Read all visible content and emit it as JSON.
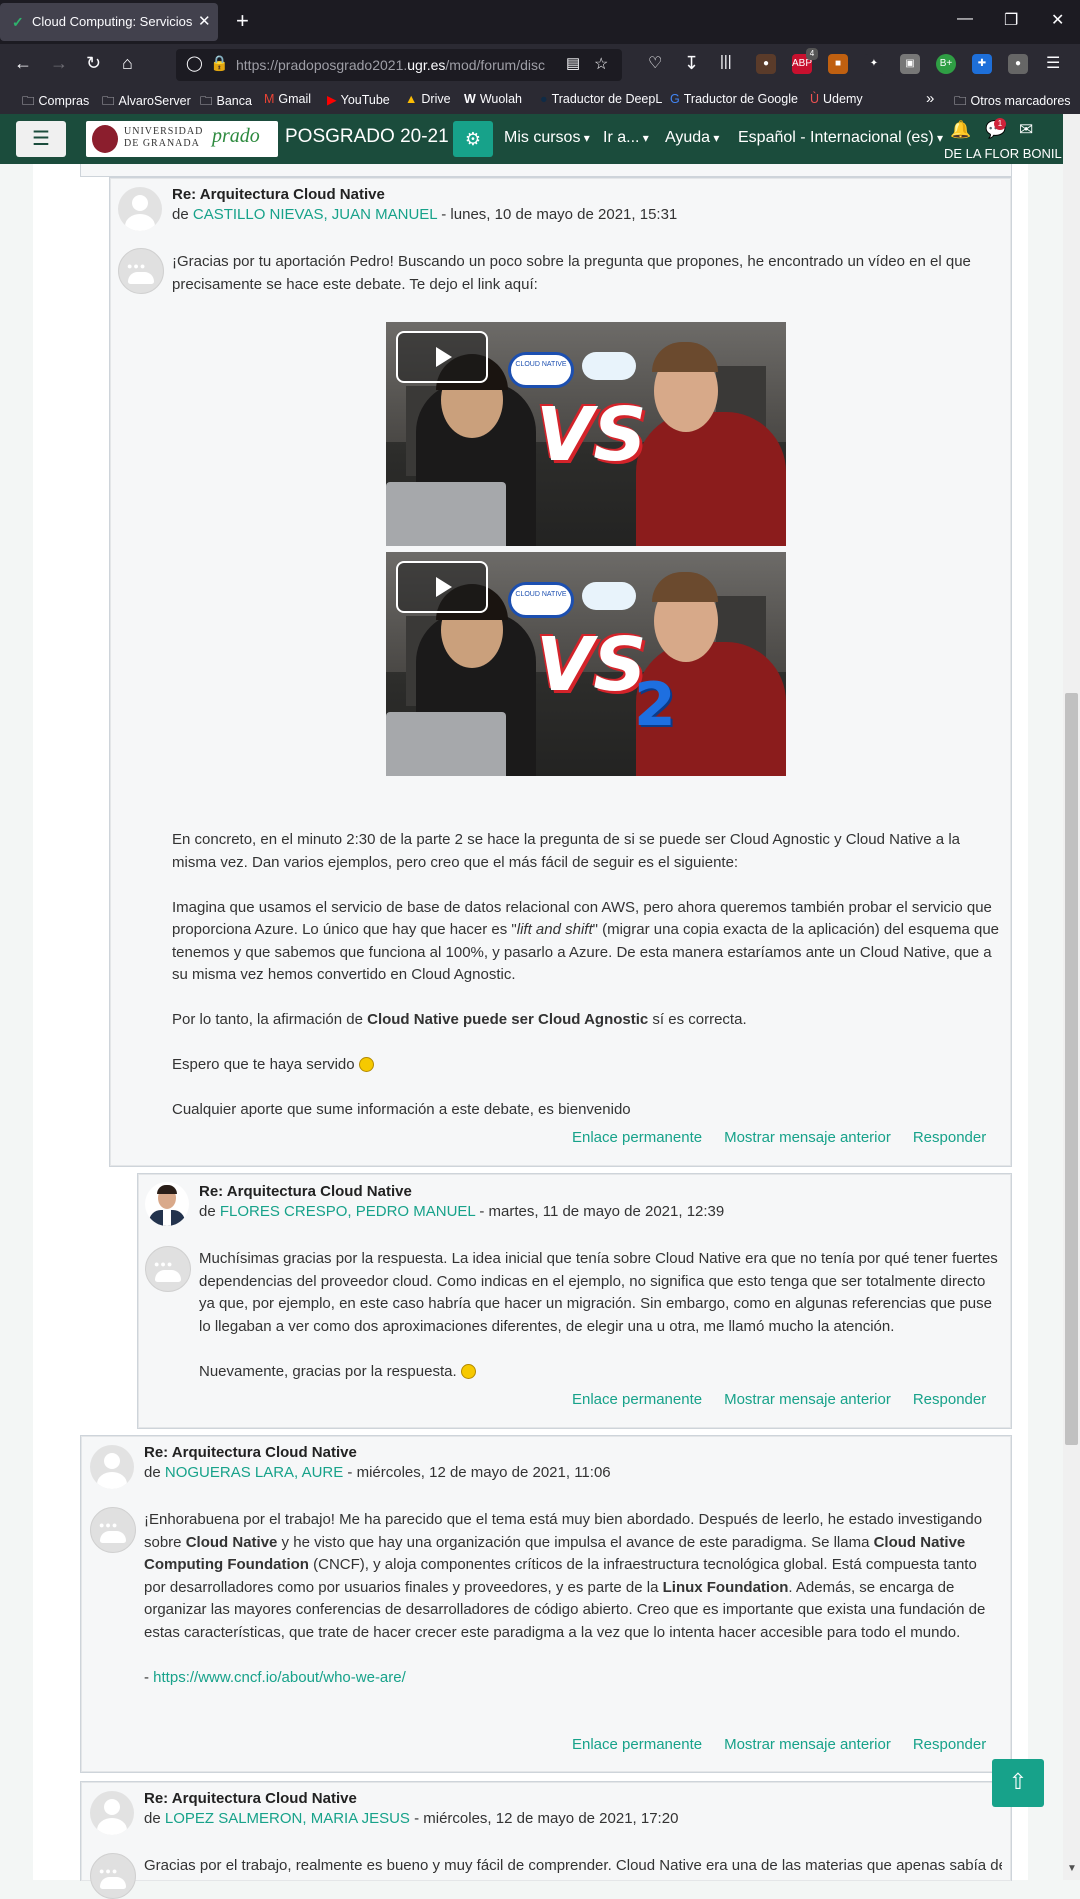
{
  "browser": {
    "tab_title": "Cloud Computing: Servicios y A",
    "url_prefix": "https://pradoposgrado2021.",
    "url_domain": "ugr.es",
    "url_suffix": "/mod/forum/disc",
    "bookmarks": [
      "Compras",
      "AlvaroServer",
      "Banca",
      "Gmail",
      "YouTube",
      "Drive",
      "Wuolah",
      "Traductor de DeepL",
      "Traductor de Google",
      "Udemy"
    ],
    "other_bookmarks": "Otros marcadores",
    "ext_badge": "4"
  },
  "header": {
    "university": "UNIVERSIDAD\nDE GRANADA",
    "prado": "prado",
    "site_title": "POSGRADO 20-21",
    "menu": [
      "Mis cursos",
      "Ir a...",
      "Ayuda",
      "Español - Internacional (es)"
    ],
    "notification_count": "1",
    "user_name": "DE LA FLOR BONIL"
  },
  "posts": [
    {
      "title": "Re: Arquitectura Cloud Native",
      "by": "de",
      "author": "CASTILLO NIEVAS, JUAN MANUEL",
      "date": " - lunes, 10 de mayo de 2021, 15:31",
      "intro": "¡Gracias por tu aportación Pedro! Buscando un poco sobre la pregunta que propones, he encontrado un vídeo en el que precisamente se hace este debate. Te dejo el link aquí:",
      "videos": [
        {
          "cloud_label": "CLOUD NATIVE",
          "vs": "VS",
          "part": ""
        },
        {
          "cloud_label": "CLOUD NATIVE",
          "vs": "VS",
          "part": "2"
        }
      ],
      "p1": "En concreto, en el minuto 2:30 de la parte 2 se hace la pregunta de si se puede ser Cloud Agnostic y Cloud Native a la misma vez. Dan varios ejemplos, pero creo que el más fácil de seguir es el siguiente:",
      "p2a": "Imagina que usamos el servicio de base de datos relacional con AWS, pero ahora queremos también probar el servicio que proporciona Azure. Lo único que hay que hacer es \"",
      "p2em": "lift and shift",
      "p2b": "\" (migrar una copia exacta de la aplicación) del esquema que tenemos y que sabemos que funciona al 100%, y pasarlo a Azure. De esta manera estaríamos ante un Cloud Native, que a su misma vez hemos convertido en Cloud Agnostic.",
      "p3a": "Por lo tanto, la afirmación de ",
      "p3b": "Cloud Native puede ser Cloud Agnostic",
      "p3c": " sí es correcta.",
      "p4": "Espero que te haya servido ",
      "p5": "Cualquier aporte que sume información a este debate, es bienvenido"
    },
    {
      "title": "Re: Arquitectura Cloud Native",
      "by": "de",
      "author": "FLORES CRESPO, PEDRO MANUEL",
      "date": " - martes, 11 de mayo de 2021, 12:39",
      "p1": "Muchísimas gracias por la respuesta. La idea inicial que tenía sobre Cloud Native era que no tenía por qué tener fuertes dependencias del proveedor cloud. Como indicas en el ejemplo, no significa que esto tenga que ser totalmente directo ya que, por ejemplo, en este caso habría que hacer un migración. Sin embargo, como en algunas referencias que puse lo llegaban a ver como dos aproximaciones diferentes, de elegir una u otra, me llamó mucho la atención.",
      "p2": "Nuevamente, gracias por la respuesta. "
    },
    {
      "title": "Re: Arquitectura Cloud Native",
      "by": "de",
      "author": "NOGUERAS LARA, AURE",
      "date": " - miércoles, 12 de mayo de 2021, 11:06",
      "t1": "¡Enhorabuena por el trabajo! Me ha parecido que el tema está muy bien abordado. Después de leerlo, he estado investigando sobre ",
      "b1": "Cloud Native",
      "t2": " y he visto que hay una organización que impulsa el avance de este paradigma. Se llama ",
      "b2": "Cloud Native Computing Foundation",
      "t3": " (CNCF), y aloja componentes críticos de la infraestructura tecnológica global. Está compuesta tanto por desarrolladores como por usuarios finales y proveedores, y es parte de la ",
      "b3": "Linux Foundation",
      "t4": ". Además, se encarga de organizar las mayores conferencias de desarrolladores de código abierto. Creo que es importante que exista una fundación de estas características, que trate de hacer crecer este paradigma a la vez que lo intenta hacer accesible para todo el mundo.",
      "dash": "- ",
      "link": "https://www.cncf.io/about/who-we-are/"
    },
    {
      "title": "Re: Arquitectura Cloud Native",
      "by": "de",
      "author": "LOPEZ SALMERON, MARIA JESUS",
      "date": " - miércoles, 12 de mayo de 2021, 17:20",
      "p1": "Gracias por el trabajo, realmente es bueno y muy fácil de comprender. Cloud Native era una de las materias que apenas sabía de"
    }
  ],
  "actions": {
    "permalink": "Enlace permanente",
    "show_parent": "Mostrar mensaje anterior",
    "reply": "Responder"
  },
  "colors": {
    "brand": "#1b4c3c",
    "accent": "#17a28a"
  }
}
